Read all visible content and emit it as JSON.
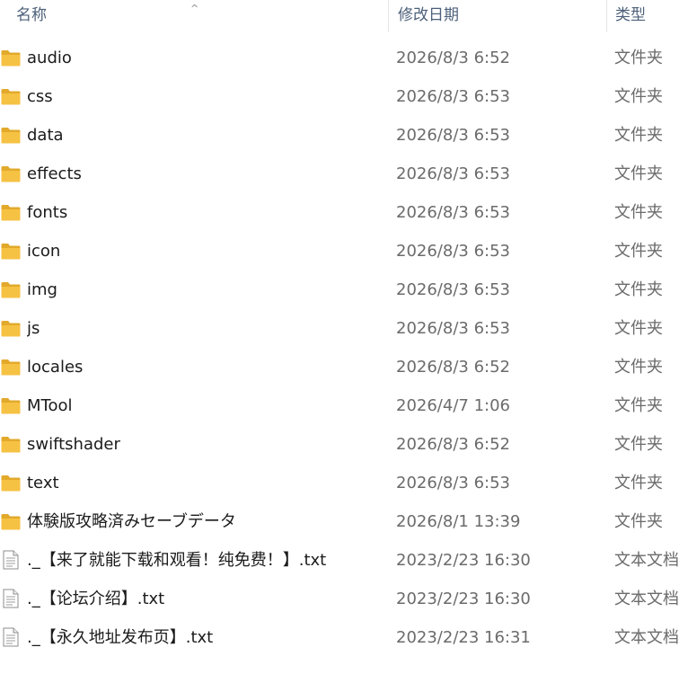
{
  "columns": {
    "name": "名称",
    "date": "修改日期",
    "type": "类型",
    "sort_indicator": "^"
  },
  "colors": {
    "folder": "#F6C244",
    "folder_dark": "#E2A92B",
    "text": "#1B1B1B",
    "muted": "#6B6B6B",
    "header": "#4C607A"
  },
  "rows": [
    {
      "icon": "folder-icon",
      "name": "audio",
      "date": "2026/8/3 6:52",
      "type": "文件夹"
    },
    {
      "icon": "folder-icon",
      "name": "css",
      "date": "2026/8/3 6:53",
      "type": "文件夹"
    },
    {
      "icon": "folder-icon",
      "name": "data",
      "date": "2026/8/3 6:53",
      "type": "文件夹"
    },
    {
      "icon": "folder-icon",
      "name": "effects",
      "date": "2026/8/3 6:53",
      "type": "文件夹"
    },
    {
      "icon": "folder-icon",
      "name": "fonts",
      "date": "2026/8/3 6:53",
      "type": "文件夹"
    },
    {
      "icon": "folder-icon",
      "name": "icon",
      "date": "2026/8/3 6:53",
      "type": "文件夹"
    },
    {
      "icon": "folder-icon",
      "name": "img",
      "date": "2026/8/3 6:53",
      "type": "文件夹"
    },
    {
      "icon": "folder-icon",
      "name": "js",
      "date": "2026/8/3 6:53",
      "type": "文件夹"
    },
    {
      "icon": "folder-icon",
      "name": "locales",
      "date": "2026/8/3 6:52",
      "type": "文件夹"
    },
    {
      "icon": "folder-icon",
      "name": "MTool",
      "date": "2026/4/7 1:06",
      "type": "文件夹"
    },
    {
      "icon": "folder-icon",
      "name": "swiftshader",
      "date": "2026/8/3 6:52",
      "type": "文件夹"
    },
    {
      "icon": "folder-icon",
      "name": "text",
      "date": "2026/8/3 6:53",
      "type": "文件夹"
    },
    {
      "icon": "folder-icon",
      "name": "体験版攻略済みセーブデータ",
      "date": "2026/8/1 13:39",
      "type": "文件夹"
    },
    {
      "icon": "text-file-icon",
      "name": "._【来了就能下载和观看！纯免费！】.txt",
      "date": "2023/2/23 16:30",
      "type": "文本文档"
    },
    {
      "icon": "text-file-icon",
      "name": "._【论坛介绍】.txt",
      "date": "2023/2/23 16:30",
      "type": "文本文档"
    },
    {
      "icon": "text-file-icon",
      "name": "._【永久地址发布页】.txt",
      "date": "2023/2/23 16:31",
      "type": "文本文档"
    }
  ]
}
